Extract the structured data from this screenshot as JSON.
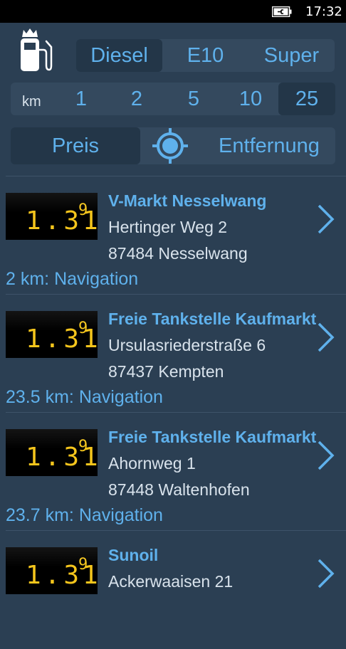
{
  "status_bar": {
    "time": "17:32"
  },
  "colors": {
    "background": "#2b3f53",
    "accent": "#5fb1ec",
    "price_digits": "#f4c51c"
  },
  "fuel_types": {
    "options": [
      "Diesel",
      "E10",
      "Super"
    ],
    "selected": "Diesel"
  },
  "radius": {
    "unit_label": "km",
    "options": [
      "1",
      "2",
      "5",
      "10",
      "25"
    ],
    "selected": "25"
  },
  "sort": {
    "price_label": "Preis",
    "distance_label": "Entfernung",
    "selected": "Preis"
  },
  "stations": [
    {
      "price_main": "1.31",
      "price_sup": "9",
      "name": "V-Markt Nesselwang",
      "street": "Hertinger Weg 2",
      "city": "87484 Nesselwang",
      "nav_text": "2 km: Navigation"
    },
    {
      "price_main": "1.31",
      "price_sup": "9",
      "name": "Freie Tankstelle Kaufmarkt",
      "street": "Ursulasriederstraße 6",
      "city": "87437 Kempten",
      "nav_text": "23.5 km: Navigation"
    },
    {
      "price_main": "1.31",
      "price_sup": "9",
      "name": "Freie Tankstelle Kaufmarkt",
      "street": "Ahornweg 1",
      "city": "87448 Waltenhofen",
      "nav_text": "23.7 km: Navigation"
    },
    {
      "price_main": "1.31",
      "price_sup": "9",
      "name": "Sunoil",
      "street": "Ackerwaaisen 21",
      "city": "",
      "nav_text": ""
    }
  ]
}
